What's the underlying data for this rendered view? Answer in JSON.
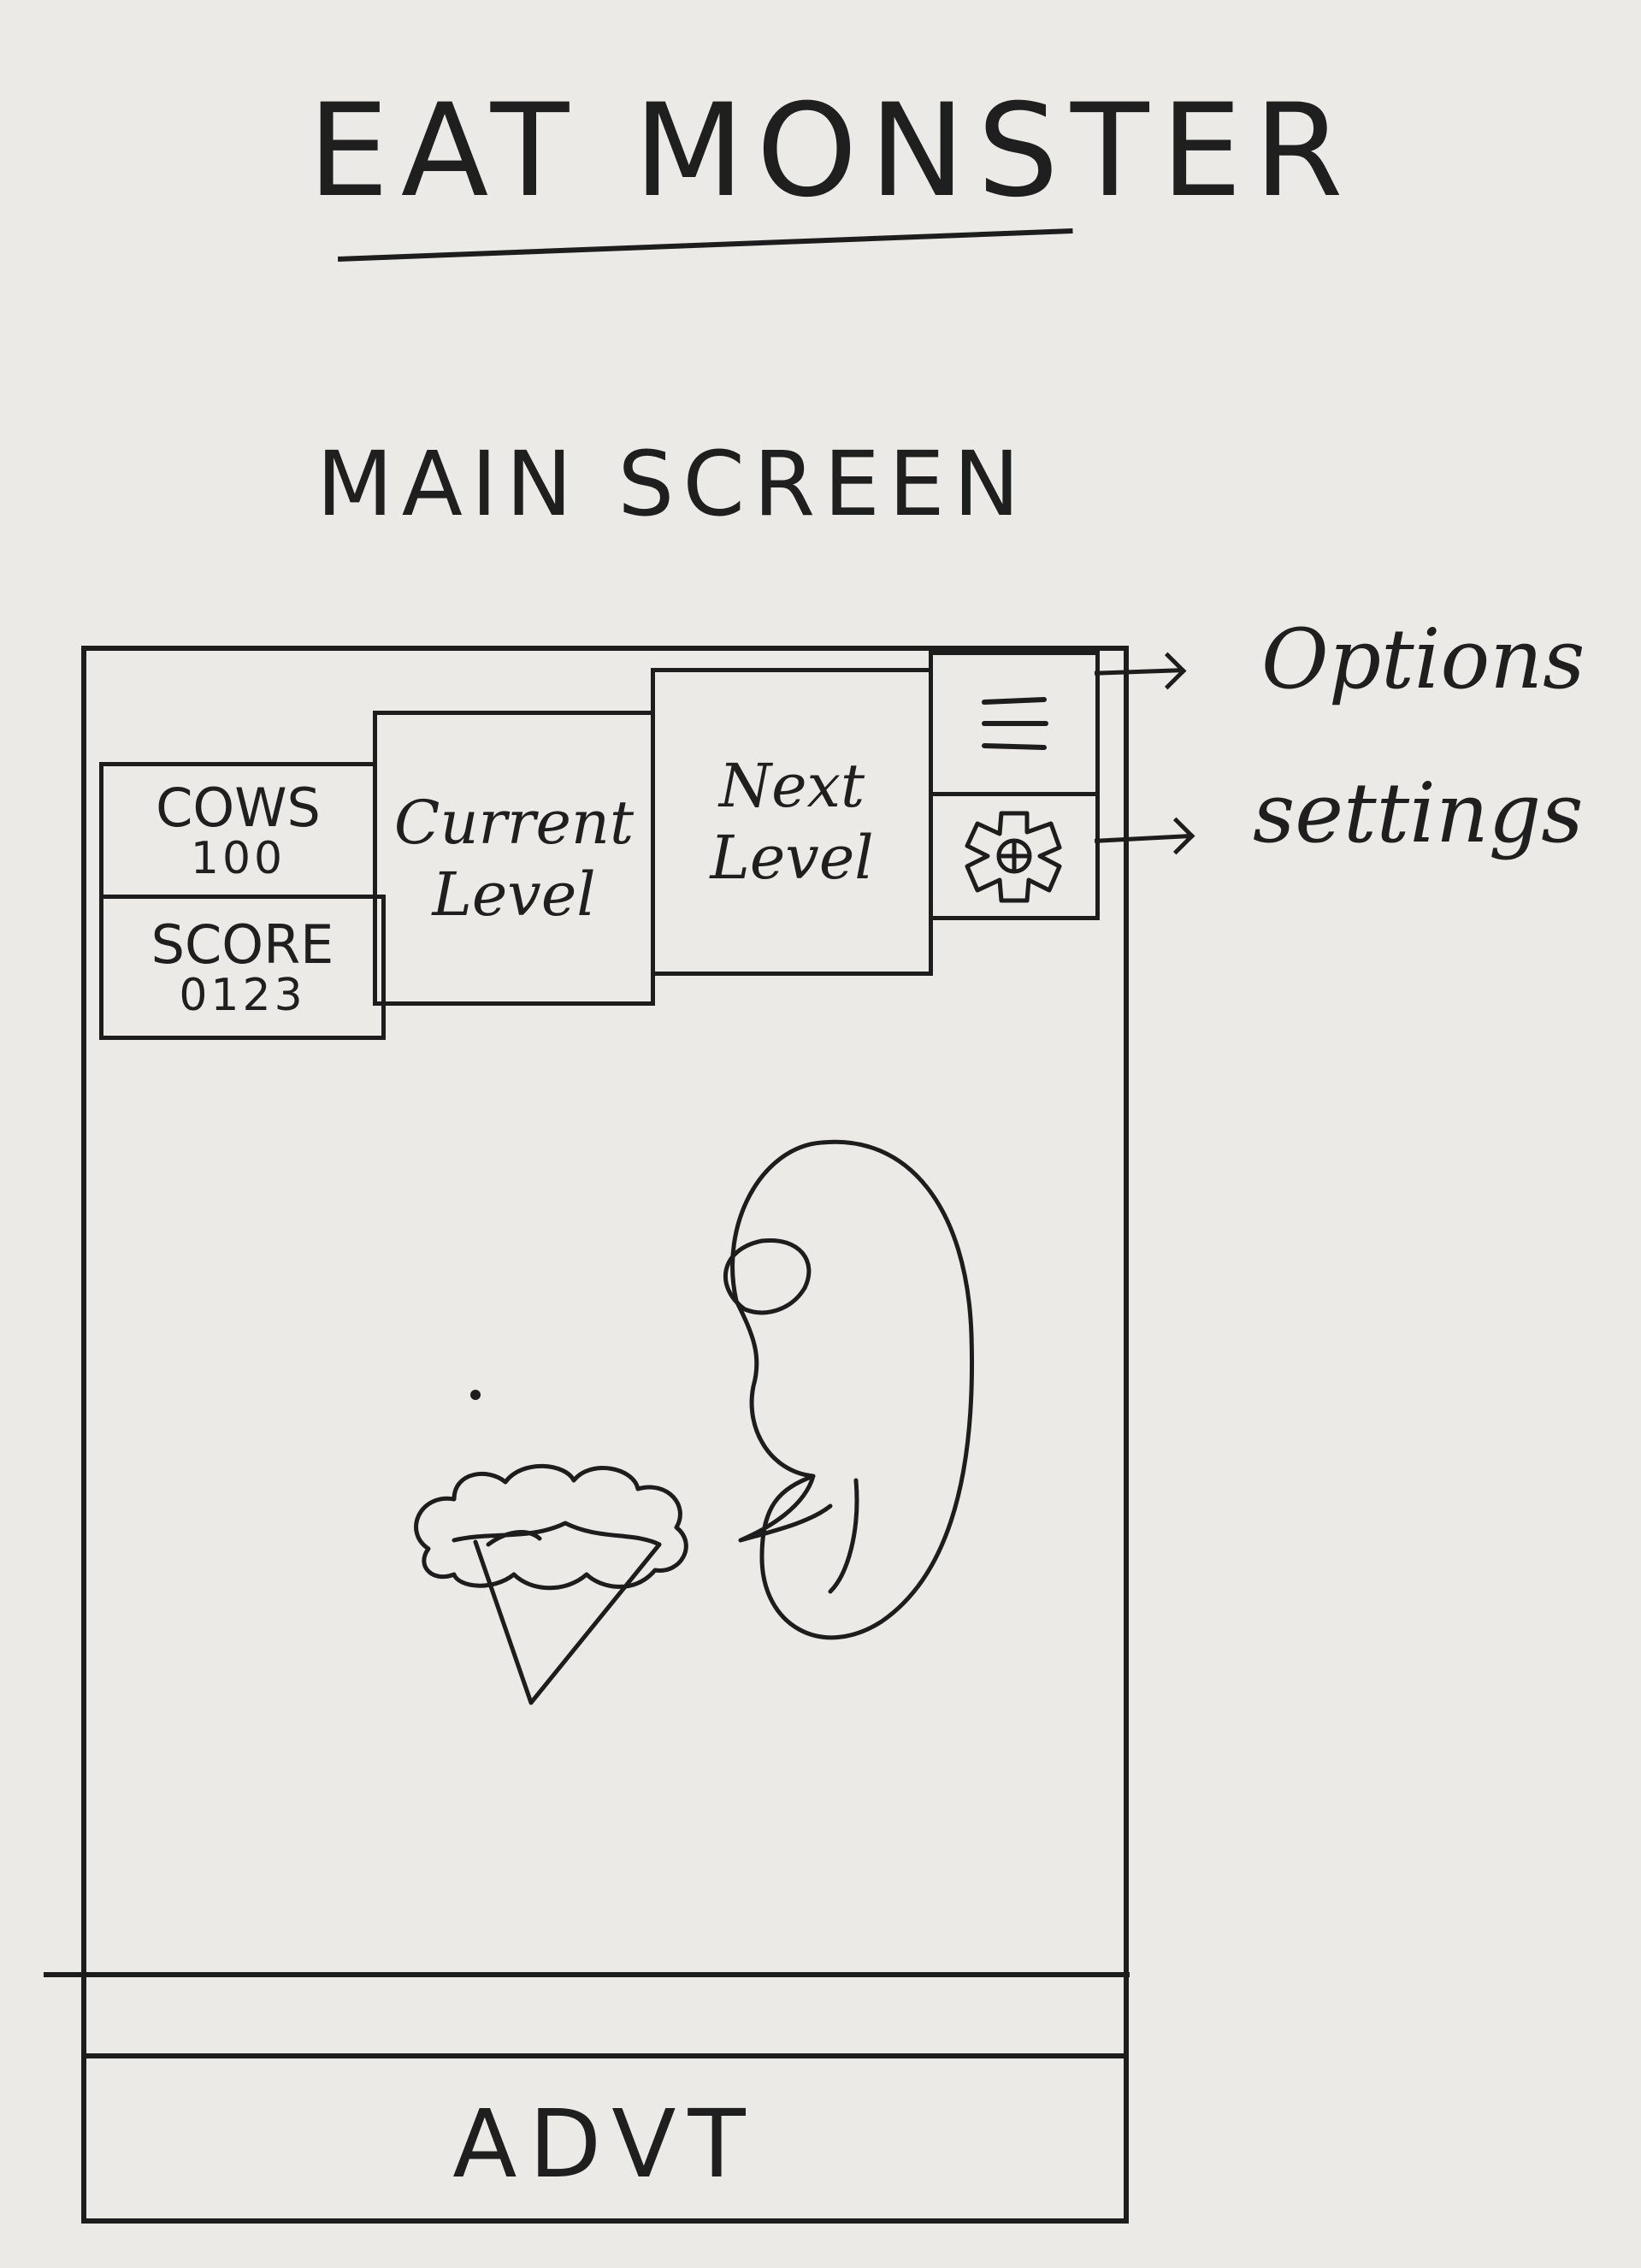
{
  "title": "EAT MONSTER",
  "subtitle": "MAIN SCREEN",
  "topbar": {
    "cows_label": "COWS",
    "cows_value": "100",
    "score_label": "SCORE",
    "score_value": "0123",
    "current_level": "Current Level",
    "next_level": "Next Level"
  },
  "annotations": {
    "options": "Options",
    "settings": "settings"
  },
  "ad": {
    "label": "ADVT"
  },
  "icons": {
    "options": "hamburger-menu-icon",
    "settings": "gear-icon"
  },
  "colors": {
    "ink": "#1d1d1d",
    "paper": "#ebeae6"
  }
}
